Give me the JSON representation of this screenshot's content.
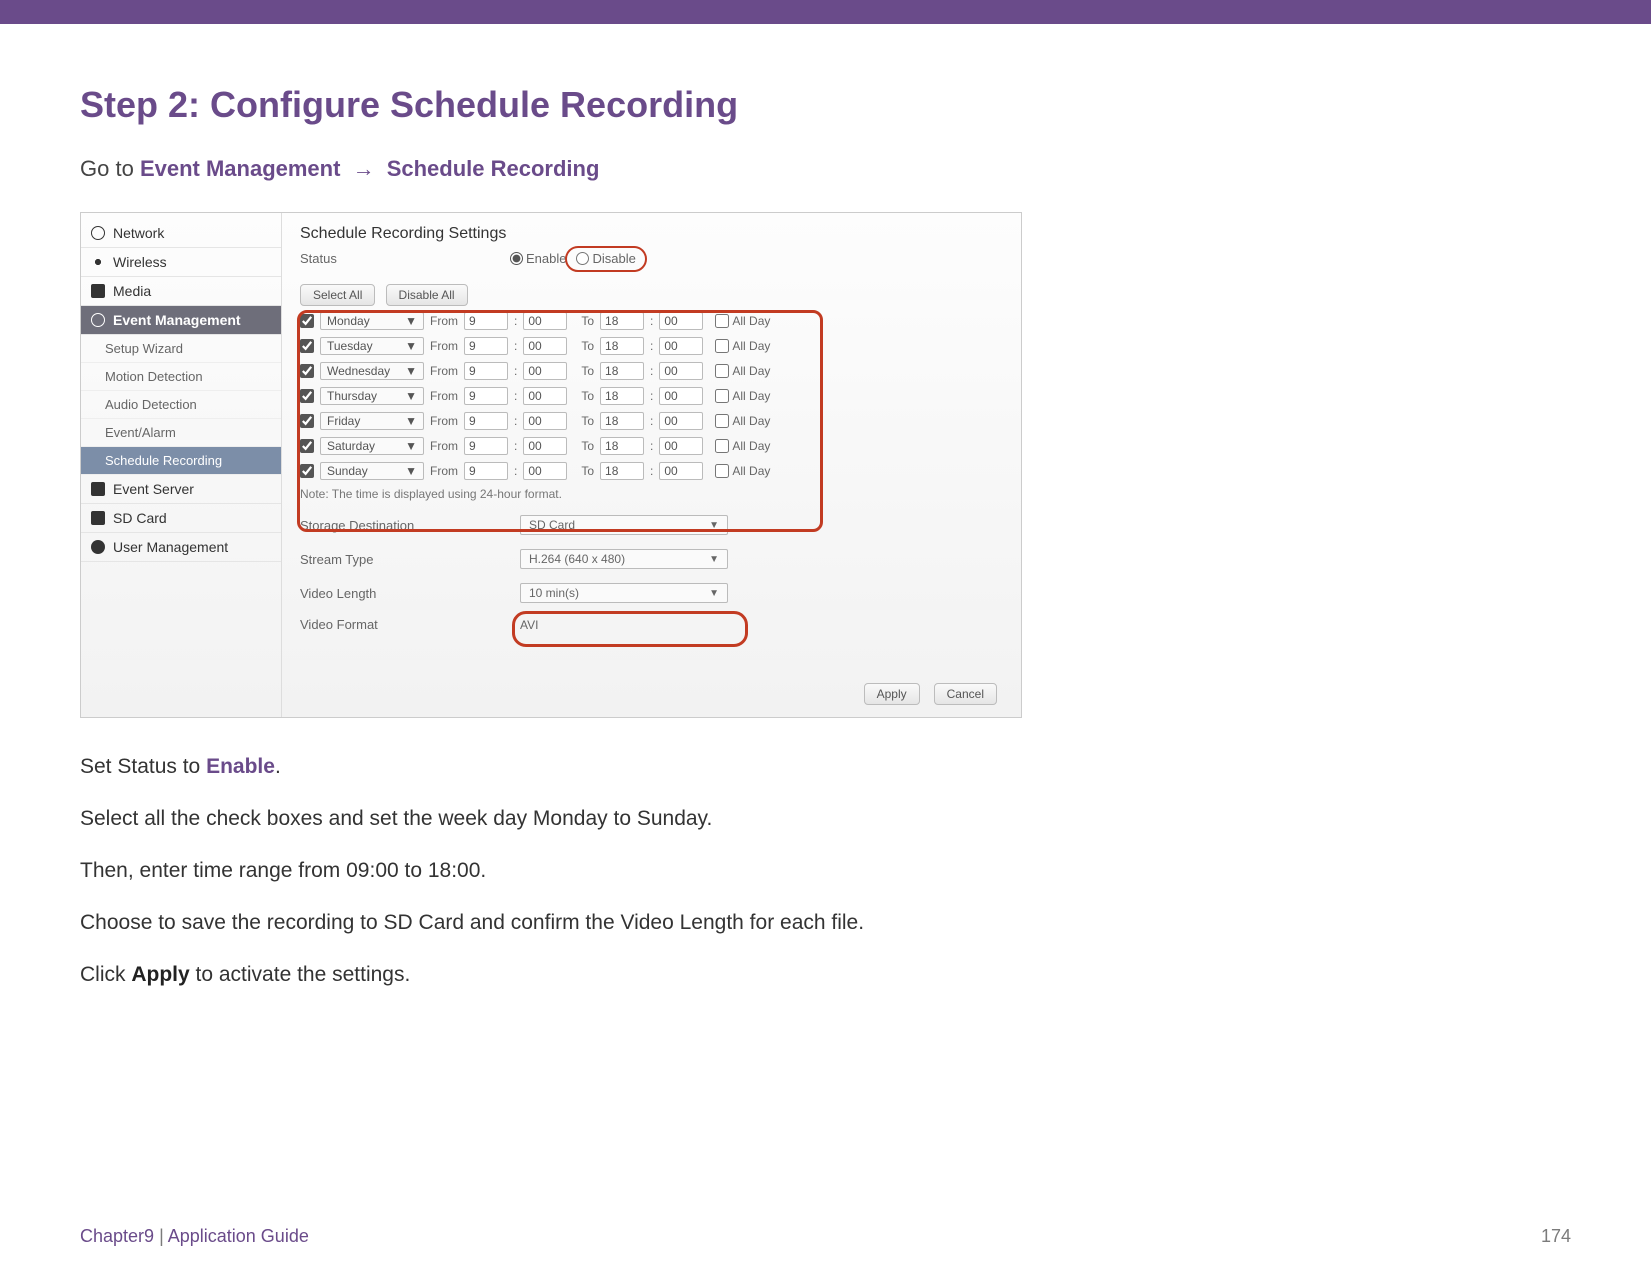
{
  "heading": "Step 2: Configure Schedule Recording",
  "goto": {
    "prefix": "Go to",
    "path1": "Event Management",
    "path2": "Schedule Recording"
  },
  "sidebar": {
    "items": [
      {
        "label": "Network"
      },
      {
        "label": "Wireless"
      },
      {
        "label": "Media"
      },
      {
        "label": "Event Management"
      },
      {
        "label": "Setup Wizard"
      },
      {
        "label": "Motion Detection"
      },
      {
        "label": "Audio Detection"
      },
      {
        "label": "Event/Alarm"
      },
      {
        "label": "Schedule Recording"
      },
      {
        "label": "Event Server"
      },
      {
        "label": "SD Card"
      },
      {
        "label": "User Management"
      }
    ]
  },
  "pane": {
    "title": "Schedule Recording Settings",
    "status_label": "Status",
    "enable": "Enable",
    "disable": "Disable",
    "select_all": "Select All",
    "disable_all": "Disable All",
    "from": "From",
    "to": "To",
    "allday": "All Day",
    "days": [
      "Monday",
      "Tuesday",
      "Wednesday",
      "Thursday",
      "Friday",
      "Saturday",
      "Sunday"
    ],
    "time": {
      "fh": "9",
      "fm": "00",
      "th": "18",
      "tm": "00",
      "tm_last": "00"
    },
    "note": "Note: The time is displayed using 24-hour format.",
    "storage_label": "Storage Destination",
    "storage_value": "SD Card",
    "stream_label": "Stream Type",
    "stream_value": "H.264 (640 x 480)",
    "vlen_label": "Video Length",
    "vlen_value": "10 min(s)",
    "vfmt_label": "Video Format",
    "vfmt_value": "AVI",
    "apply": "Apply",
    "cancel": "Cancel"
  },
  "instructions": {
    "p1a": "Set Status to ",
    "p1b": "Enable",
    "p1c": ".",
    "p2": "Select all the check boxes and set the week day Monday to Sunday.",
    "p3": "Then, enter time range from 09:00 to 18:00.",
    "p4": "Choose to save the recording to SD Card and confirm the Video Length for each file.",
    "p5a": "Click ",
    "p5b": "Apply",
    "p5c": " to activate the settings."
  },
  "footer": {
    "chapter": "Chapter9",
    "sep": "  |  ",
    "section": "Application Guide",
    "page": "174"
  }
}
